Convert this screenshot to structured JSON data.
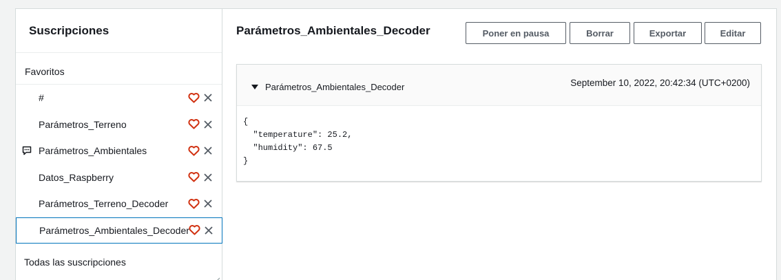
{
  "subscriptions_panel": {
    "title": "Suscripciones",
    "favorites_label": "Favoritos",
    "items": [
      {
        "label": "#"
      },
      {
        "label": "Parámetros_Terreno"
      },
      {
        "label": "Parámetros_Ambientales",
        "has_message_icon": true
      },
      {
        "label": "Datos_Raspberry"
      },
      {
        "label": "Parámetros_Terreno_Decoder"
      },
      {
        "label": "Parámetros_Ambientales_Decoder",
        "selected": true
      }
    ],
    "all_subscriptions_label": "Todas las suscripciones"
  },
  "main": {
    "title": "Parámetros_Ambientales_Decoder",
    "buttons": {
      "pause": "Poner en pausa",
      "delete": "Borrar",
      "export": "Exportar",
      "edit": "Editar"
    },
    "message": {
      "topic": "Parámetros_Ambientales_Decoder",
      "timestamp": "September 10, 2022, 20:42:34 (UTC+0200)",
      "payload": "{\n  \"temperature\": 25.2,\n  \"humidity\": 67.5\n}"
    }
  },
  "colors": {
    "heart": "#d13212",
    "close": "#545b64",
    "selected_border": "#0073bb"
  },
  "icons": {
    "favorite": "heart-outline-icon",
    "remove": "close-icon",
    "message": "message-icon",
    "expand": "caret-down-icon"
  }
}
